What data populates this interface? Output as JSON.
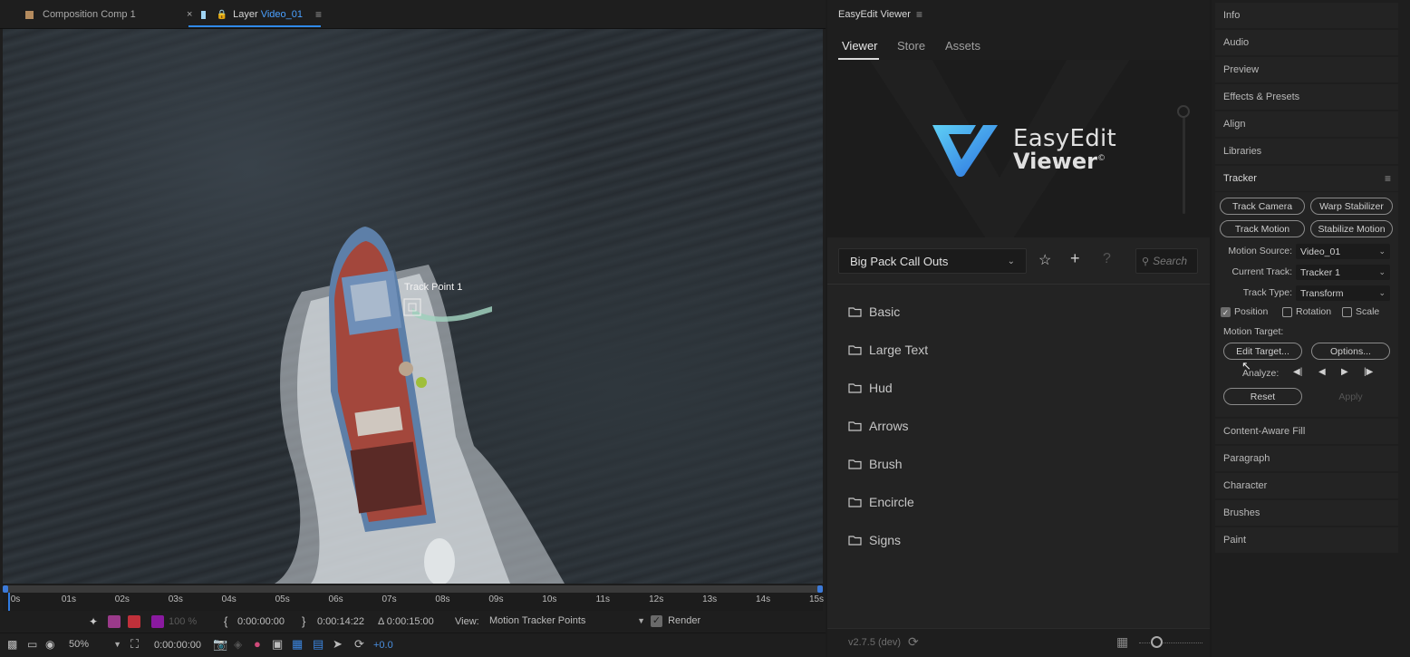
{
  "left": {
    "tabs": [
      {
        "label": "Composition Comp 1"
      },
      {
        "label_prefix": "Layer",
        "label_name": "Video_01"
      }
    ],
    "overlay": {
      "track_point_label": "Track Point 1"
    },
    "ruler": {
      "ticks": [
        "0s",
        "01s",
        "02s",
        "03s",
        "04s",
        "05s",
        "06s",
        "07s",
        "08s",
        "09s",
        "10s",
        "11s",
        "12s",
        "13s",
        "14s",
        "15s"
      ]
    },
    "controls1": {
      "opacity": "100 %",
      "in_time": "0:00:00:00",
      "out_time": "0:00:14:22",
      "duration": "Δ 0:00:15:00",
      "view_label": "View:",
      "view_value": "Motion Tracker Points",
      "render_label": "Render"
    },
    "controls2": {
      "zoom": "50%",
      "timecode": "0:00:00:00",
      "exposure": "+0.0"
    }
  },
  "mid": {
    "title": "EasyEdit Viewer",
    "tabs": [
      "Viewer",
      "Store",
      "Assets"
    ],
    "active_tab": "Viewer",
    "logo": {
      "line1": "EasyEdit",
      "line2": "Viewer",
      "mark": "©"
    },
    "pack": {
      "selected": "Big Pack Call Outs"
    },
    "search": {
      "placeholder": "Search"
    },
    "folders": [
      "Basic",
      "Large Text",
      "Hud",
      "Arrows",
      "Brush",
      "Encircle",
      "Signs"
    ],
    "version": "v2.7.5 (dev)"
  },
  "right": {
    "panels_top": [
      "Info",
      "Audio",
      "Preview",
      "Effects & Presets",
      "Align",
      "Libraries"
    ],
    "tracker": {
      "title": "Tracker",
      "buttons": [
        "Track Camera",
        "Warp Stabilizer",
        "Track Motion",
        "Stabilize Motion"
      ],
      "motion_source_label": "Motion Source:",
      "motion_source_value": "Video_01",
      "current_track_label": "Current Track:",
      "current_track_value": "Tracker 1",
      "track_type_label": "Track Type:",
      "track_type_value": "Transform",
      "position_label": "Position",
      "rotation_label": "Rotation",
      "scale_label": "Scale",
      "motion_target_label": "Motion Target:",
      "edit_target_label": "Edit Target...",
      "options_label": "Options...",
      "analyze_label": "Analyze:",
      "reset_label": "Reset",
      "apply_label": "Apply"
    },
    "panels_bottom": [
      "Content-Aware Fill",
      "Paragraph",
      "Character",
      "Brushes",
      "Paint"
    ]
  }
}
